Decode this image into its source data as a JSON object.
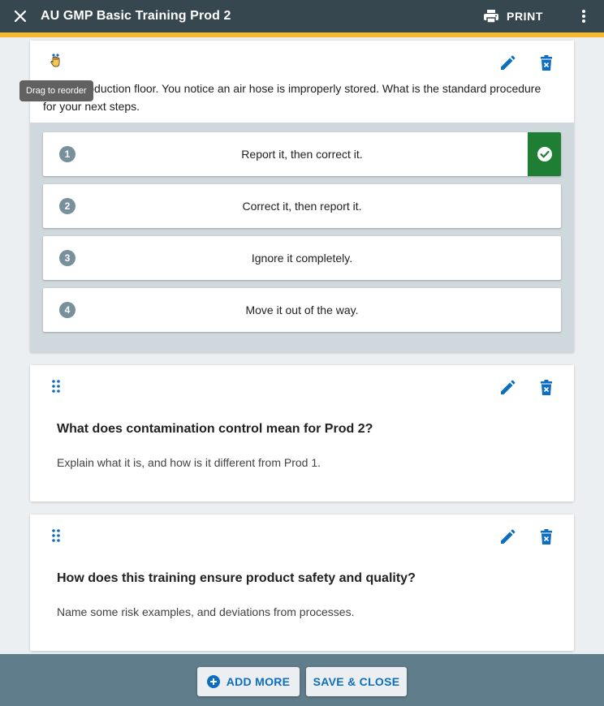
{
  "header": {
    "title": "AU GMP Basic Training Prod 2",
    "print_label": "PRINT",
    "icons": {
      "close": "close-icon",
      "print": "printer-icon",
      "more": "more-vert-icon"
    },
    "colors": {
      "bar": "#37474f",
      "accent": "#f5b82e"
    }
  },
  "tooltip": "Drag to reorder",
  "questions": [
    {
      "text": "You're on the production floor. You notice an air hose is improperly stored. What is the standard procedure for your next steps.",
      "visible_text": "on the production floor. You notice an air hose is improperly stored. What is the standard procedure for your next steps.",
      "options": [
        {
          "number": "1",
          "label": "Report it, then correct it.",
          "correct": true
        },
        {
          "number": "2",
          "label": "Correct it, then report it.",
          "correct": false
        },
        {
          "number": "3",
          "label": "Ignore it completely.",
          "correct": false
        },
        {
          "number": "4",
          "label": "Move it out of the way.",
          "correct": false
        }
      ]
    },
    {
      "title": "What does contamination control mean for Prod 2?",
      "description": "Explain what it is, and how is it different from Prod 1."
    },
    {
      "title": "How does this training ensure product safety and quality?",
      "description": "Name some risk examples, and deviations from processes."
    }
  ],
  "footer": {
    "add_more_label": "ADD MORE",
    "save_close_label": "SAVE & CLOSE",
    "colors": {
      "bar": "#607d8b",
      "button_text": "#0d6ebd",
      "correct": "#1e7e34"
    }
  }
}
